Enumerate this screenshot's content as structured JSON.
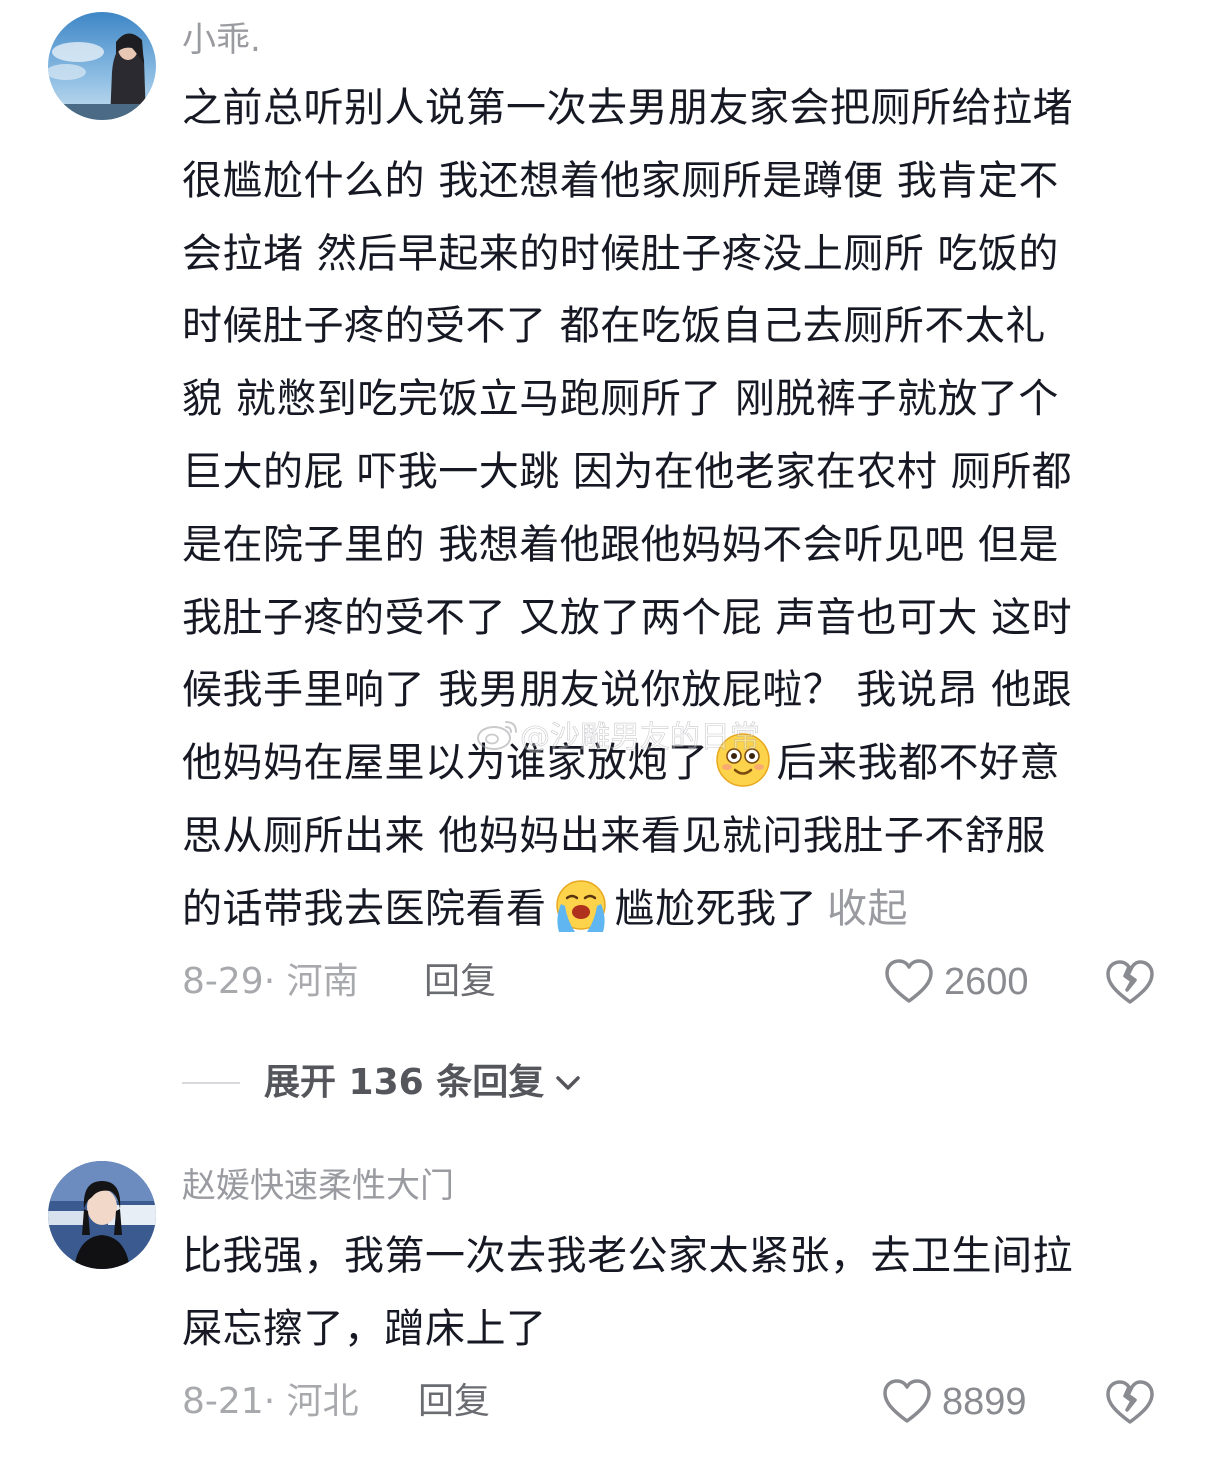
{
  "comments": [
    {
      "username": "小乖.",
      "lines": [
        "之前总听别人说第一次去男朋友家会把厕所给拉堵",
        "很尴尬什么的 我还想着他家厕所是蹲便 我肯定不",
        "会拉堵 然后早起来的时候肚子疼没上厕所 吃饭的",
        "时候肚子疼的受不了 都在吃饭自己去厕所不太礼",
        "貌 就憋到吃完饭立马跑厕所了 刚脱裤子就放了个",
        "巨大的屁 吓我一大跳 因为在他老家在农村 厕所都",
        "是在院子里的 我想着他跟他妈妈不会听见吧 但是",
        "我肚子疼的受不了 又放了两个屁 声音也可大 这时",
        "候我手里响了 我男朋友说你放屁啦？ 我说昂 他跟"
      ],
      "line_with_emoji_1": {
        "before": "他妈妈在屋里以为谁家放炮了",
        "emoji": "smiley-blush-emoji",
        "after": "后来我都不好意"
      },
      "line_plain_last": "思从厕所出来 他妈妈出来看见就问我肚子不舒服",
      "line_with_emoji_2": {
        "before": "的话带我去医院看看",
        "emoji": "crying-emoji",
        "after": "尴尬死我了",
        "collapse": "收起"
      },
      "date_location": "8-29· 河南",
      "reply_label": "回复",
      "like_count": "2600"
    },
    {
      "username": "赵媛快速柔性大门",
      "lines": [
        "比我强，我第一次去我老公家太紧张，去卫生间拉",
        "屎忘擦了，蹭床上了"
      ],
      "date_location": "8-21· 河北",
      "reply_label": "回复",
      "like_count": "8899"
    }
  ],
  "expand_replies": {
    "label": "展开 136 条回复"
  },
  "watermark": {
    "text": "@沙雕男友的日常"
  },
  "colors": {
    "text": "#161823",
    "secondary": "#9a9ba0",
    "icon": "#7a7b80"
  }
}
